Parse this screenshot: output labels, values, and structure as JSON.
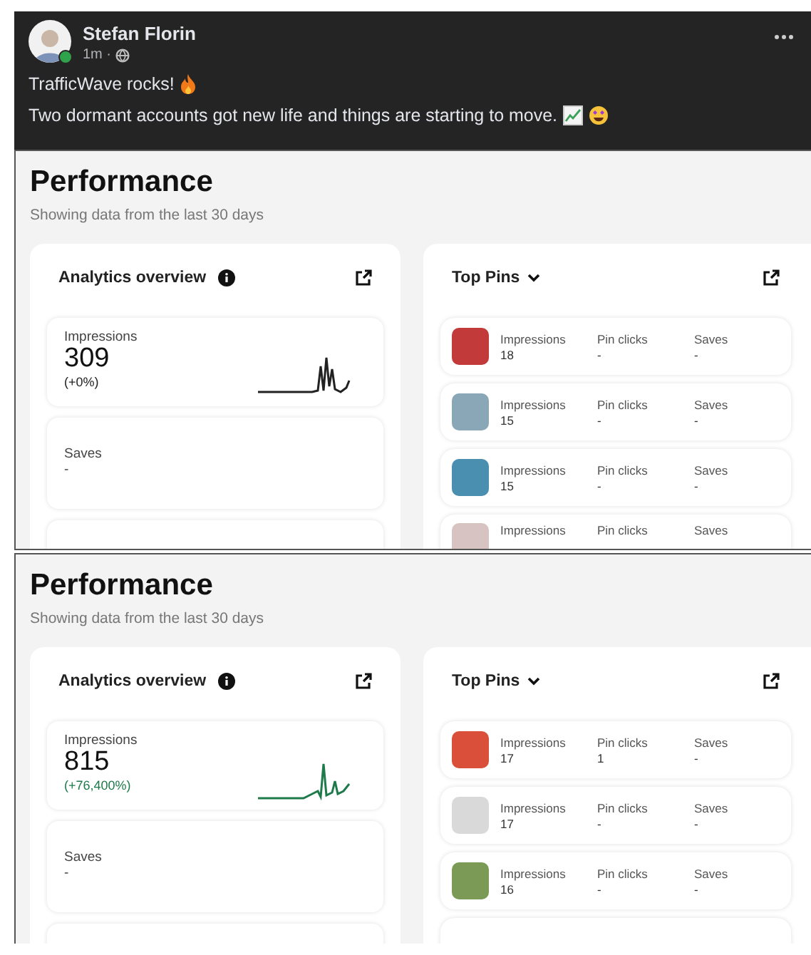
{
  "post": {
    "author": "Stefan Florin",
    "time": "1m ·",
    "online": true,
    "lines": [
      {
        "text": "TrafficWave rocks!",
        "icons": [
          {
            "kind": "fire"
          }
        ]
      },
      {
        "text": "Two dormant accounts got new life and things are starting to move.",
        "icons": [
          {
            "kind": "chart"
          },
          {
            "kind": "starface"
          }
        ]
      }
    ]
  },
  "screenshots": [
    {
      "title": "Performance",
      "subtitle": "Showing data from the last 30 days",
      "overview": {
        "title": "Analytics overview",
        "metrics": [
          {
            "kind": "sparkline",
            "label": "Impressions",
            "value": "309",
            "change": "(+0%)",
            "color": "#222222"
          },
          {
            "kind": "plain",
            "label": "Saves",
            "value": "-"
          },
          {
            "kind": "blank"
          }
        ]
      },
      "pins": {
        "title": "Top Pins",
        "rows": [
          {
            "kind": "full",
            "stats": [
              {
                "label": "Impressions",
                "value": "18"
              },
              {
                "label": "Pin clicks",
                "value": "-"
              },
              {
                "label": "Saves",
                "value": "-"
              }
            ]
          },
          {
            "kind": "full",
            "stats": [
              {
                "label": "Impressions",
                "value": "15"
              },
              {
                "label": "Pin clicks",
                "value": "-"
              },
              {
                "label": "Saves",
                "value": "-"
              }
            ]
          },
          {
            "kind": "full",
            "stats": [
              {
                "label": "Impressions",
                "value": "15"
              },
              {
                "label": "Pin clicks",
                "value": "-"
              },
              {
                "label": "Saves",
                "value": "-"
              }
            ]
          },
          {
            "kind": "partial",
            "stats": [
              {
                "label": "Impressions"
              },
              {
                "label": "Pin clicks"
              },
              {
                "label": "Saves"
              }
            ]
          }
        ]
      }
    },
    {
      "title": "Performance",
      "subtitle": "Showing data from the last 30 days",
      "overview": {
        "title": "Analytics overview",
        "metrics": [
          {
            "kind": "sparkline",
            "label": "Impressions",
            "value": "815",
            "change": "(+76,400%)",
            "color": "#1e7a4a"
          },
          {
            "kind": "plain",
            "label": "Saves",
            "value": "-"
          },
          {
            "kind": "blank"
          }
        ]
      },
      "pins": {
        "title": "Top Pins",
        "rows": [
          {
            "kind": "full",
            "stats": [
              {
                "label": "Impressions",
                "value": "17"
              },
              {
                "label": "Pin clicks",
                "value": "1"
              },
              {
                "label": "Saves",
                "value": "-"
              }
            ]
          },
          {
            "kind": "full",
            "stats": [
              {
                "label": "Impressions",
                "value": "17"
              },
              {
                "label": "Pin clicks",
                "value": "-"
              },
              {
                "label": "Saves",
                "value": "-"
              }
            ]
          },
          {
            "kind": "full",
            "stats": [
              {
                "label": "Impressions",
                "value": "16"
              },
              {
                "label": "Pin clicks",
                "value": "-"
              },
              {
                "label": "Saves",
                "value": "-"
              }
            ]
          },
          {
            "kind": "blank"
          }
        ]
      }
    }
  ]
}
